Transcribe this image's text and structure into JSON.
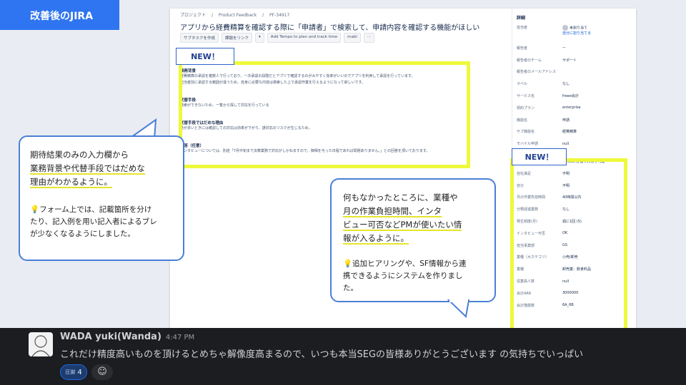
{
  "header": {
    "tab_label": "改善後のJIRA"
  },
  "jira": {
    "breadcrumb": [
      "プロジェクト",
      "/",
      "Product Feedback",
      "/",
      "PF-34917"
    ],
    "title": "アプリから経費精算を確認する際に「申請者」で検索して、申請内容を確認する機能がほしい",
    "toolbar": [
      "サブタスクを作成",
      "課題をリンク",
      "▾",
      "Add Tempo to plan and track time",
      "mabl",
      "···"
    ],
    "body": {
      "h1": "業務背景",
      "p1a": "経費精算の承認を複数人で行っており、一次承認の段階だとアプリで確認するのがみやすく効率がいいのでアプリを利用して承認を行っています。",
      "p1b": "担当者別に承認する範囲が違うため、自身に必要な内容は検索した上で承認作業を行えるようになって欲しいです。",
      "h2": "代替手段",
      "p2": "検索ができないため、一覧から探して対応を行っている",
      "h3": "代替手段ではだめな理由",
      "p3": "量が多いときには確認しての対応は効率が下がり、誤対応のリスクが生じるため。",
      "h4": "回答（任意）",
      "p4": "インタビューについては、別途「7月中旬まで決算業務で対応がしかねますので、御相を与った日程であれば問題ありません。」との回答を頂いております。"
    },
    "details": {
      "heading": "詳細",
      "assignee_label": "担当者",
      "assignee_value": "未割り当て",
      "assign_me": "自分に割り当てる",
      "rows_top": [
        {
          "label": "報告者",
          "value": "ー"
        },
        {
          "label": "報告者のチーム",
          "value": "サポート"
        },
        {
          "label": "報告者のメールアドレス",
          "value": ""
        },
        {
          "label": "ラベル",
          "value": "なし"
        },
        {
          "label": "サービス名",
          "value": "freee会計"
        },
        {
          "label": "契約プラン",
          "value": "enterprise"
        },
        {
          "label": "機能名",
          "value": "申請"
        },
        {
          "label": "サブ機能名",
          "value": "経費精算"
        },
        {
          "label": "モバイル申請",
          "value": "null"
        }
      ],
      "rows_bottom": [
        {
          "label": "代替手段の種類",
          "value": "{freee内}違う方法で可能"
        },
        {
          "label": "自社満足",
          "value": "不明"
        },
        {
          "label": "自分",
          "value": "不明"
        },
        {
          "label": "月の作業負担時間",
          "value": "40時間以内"
        },
        {
          "label": "分類促進業務",
          "value": "なし"
        },
        {
          "label": "発生頻度(月)",
          "value": "週に1回 (5)"
        },
        {
          "label": "インタビュー可否",
          "value": "OK"
        },
        {
          "label": "担当事業部",
          "value": "GS"
        },
        {
          "label": "業種（大カテゴリ）",
          "value": "小売/卸売"
        },
        {
          "label": "業種",
          "value": "卸売業：飲食料品"
        },
        {
          "label": "従業員人数",
          "value": "null"
        },
        {
          "label": "会計ARR",
          "value": "3000000"
        },
        {
          "label": "会計階層数",
          "value": "6A_6B"
        }
      ]
    }
  },
  "badges": {
    "new1": "NEW！",
    "new2": "NEW！"
  },
  "bubble_left": {
    "line1": "期待結果のみの入力欄から",
    "line2": "業務背景や代替手段ではだめな",
    "line3": "理由がわかるように。",
    "sub1": "💡フォーム上では、記載箇所を分け",
    "sub2": "たり、記入例を用い記入者によるブレ",
    "sub3": "が少なくなるようにしました。"
  },
  "bubble_right": {
    "line1": "何もなかったところに、業種や",
    "line2": "月の作業負担時間、インタ",
    "line3": "ビュー可否などPMが使いたい情",
    "line4": "報が入るように。",
    "sub1": "💡追加ヒアリングや、SF情報から連",
    "sub2": "携できるようにシステムを作りまし",
    "sub3": "た。"
  },
  "slack": {
    "user": "WADA yuki(Wanda)",
    "time": "4:47 PM",
    "message": "これだけ精度高いものを頂けるとめちゃ解像度高まるので、いつも本当SEGの皆様ありがとうございます の気持ちでいっぱい",
    "reaction_emoji": "圧謝",
    "reaction_count": "4",
    "add_reaction_icon": "add-reaction-icon"
  },
  "colors": {
    "accent": "#2f74f0",
    "highlight": "#eef93a",
    "bubble_border": "#4a7fd6",
    "slack_bg": "#1b1d21"
  }
}
